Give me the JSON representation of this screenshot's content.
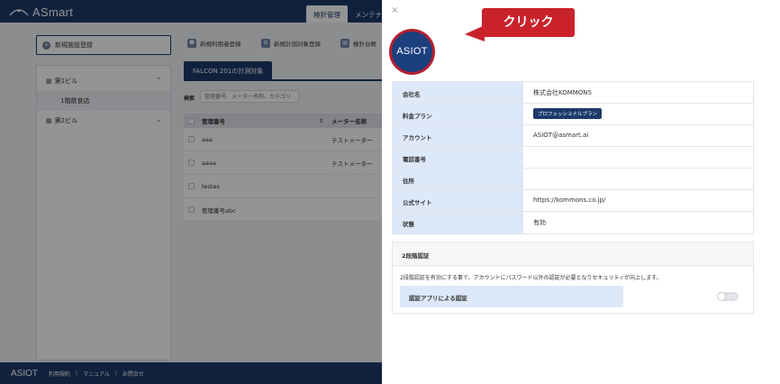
{
  "app": {
    "logo_text": "ASmart",
    "nav": {
      "active_tab": "検針管理",
      "other_tab": "メンテナ"
    },
    "new_facility_label": "新規施設登録",
    "toolbar": [
      {
        "label": "新規利用者登録",
        "icon": "user-add-icon"
      },
      {
        "label": "新規計測対象登録",
        "icon": "gauge-add-icon"
      },
      {
        "label": "検針台帳",
        "icon": "ledger-icon"
      }
    ],
    "tree": {
      "buildings": [
        {
          "label": "第1ビル",
          "expanded": true,
          "children": [
            "1階飲食店"
          ]
        },
        {
          "label": "第2ビル",
          "expanded": false,
          "children": []
        }
      ]
    },
    "tab_label": "FALCON 201の計測対象",
    "search": {
      "label": "検索",
      "placeholder": "管理番号、メーター名称、カテゴリ"
    },
    "table": {
      "headers": [
        "管理番号",
        "メーター名称"
      ],
      "rows": [
        {
          "id": "aaa",
          "meter": "テストメーター"
        },
        {
          "id": "aaaa",
          "meter": "テストメーター"
        },
        {
          "id": "testes",
          "meter": ""
        },
        {
          "id": "管理番号abc",
          "meter": ""
        }
      ]
    },
    "footer": {
      "logo": "ASIOT",
      "links": [
        "利用規約",
        "マニュアル",
        "お問合せ"
      ],
      "separator": "|"
    }
  },
  "drawer": {
    "close_symbol": "×",
    "avatar_text": "ASIOT",
    "callout_text": "クリック",
    "info": {
      "rows": [
        {
          "label": "会社名",
          "value": "株式会社KOMMONS"
        },
        {
          "label": "料金プラン",
          "value": "プロフェッショナルプラン",
          "badge": true
        },
        {
          "label": "アカウント",
          "value": "ASIOT@asmart.ai"
        },
        {
          "label": "電話番号",
          "value": ""
        },
        {
          "label": "住所",
          "value": ""
        },
        {
          "label": "公式サイト",
          "value": "https://kommons.co.jp/"
        },
        {
          "label": "状態",
          "value": "有効"
        }
      ]
    },
    "twofa": {
      "title": "2段階認証",
      "description": "2段階認証を有効にする事で、アカウントにパスワード以外の認証が必要となりセキュリティが向上します。",
      "app_auth_label": "認証アプリによる認証",
      "toggle_text": "オフ",
      "enabled": false
    }
  },
  "colors": {
    "navy": "#1c3a6b",
    "label_bg": "#dde8f8",
    "callout_red": "#c9222b",
    "avatar_ring": "#b41f2e",
    "avatar_fill": "#1c3f7e"
  }
}
